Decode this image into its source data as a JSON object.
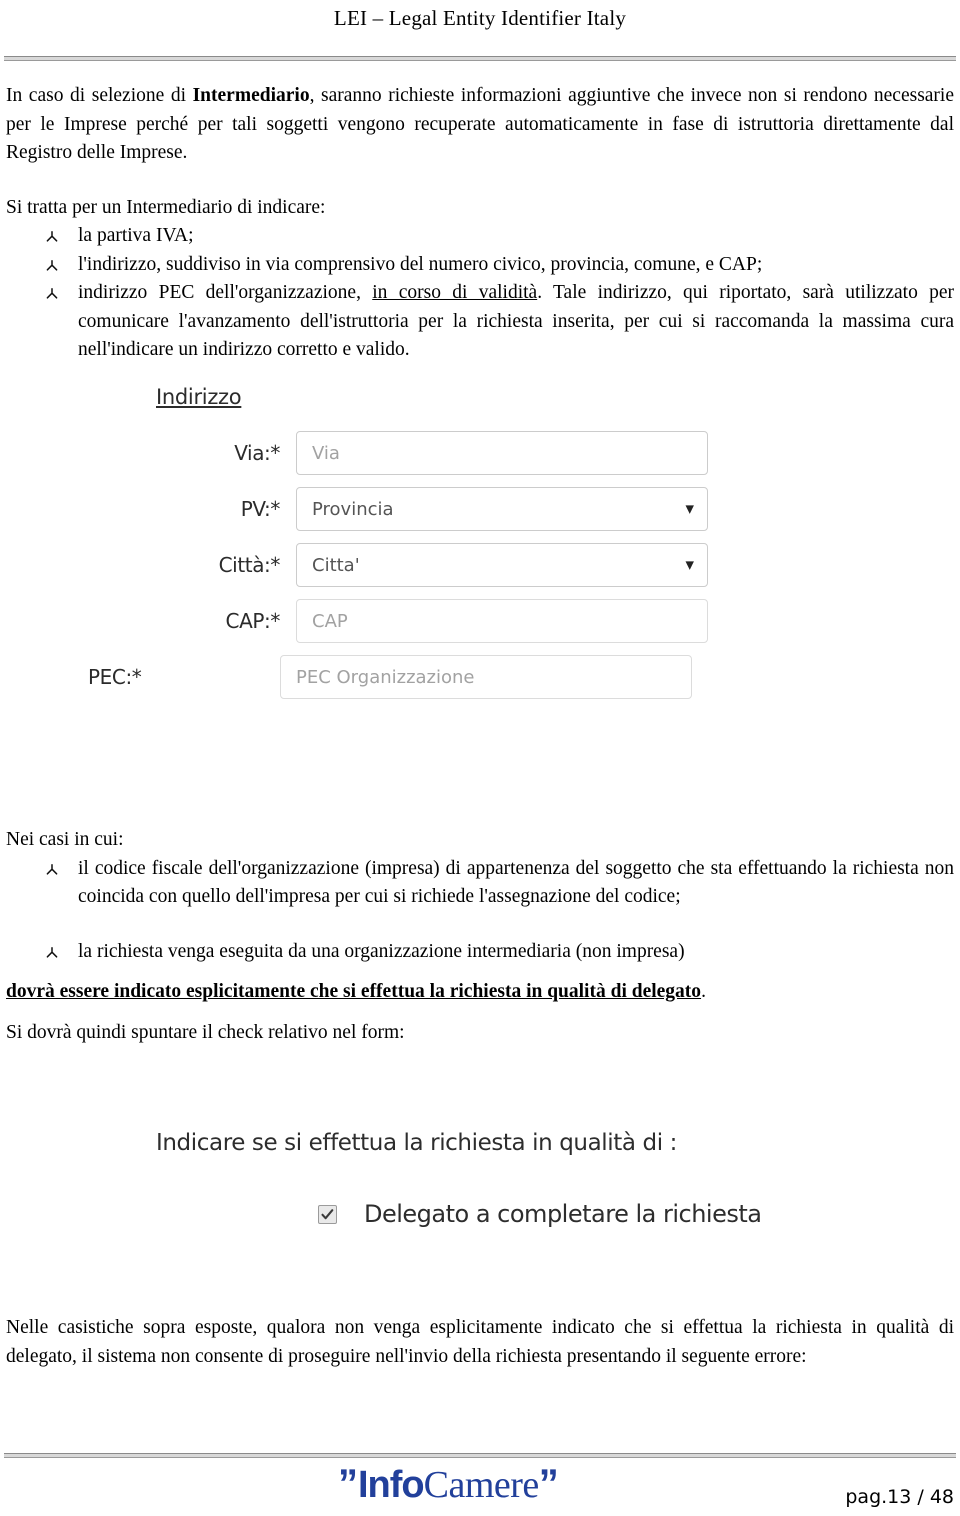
{
  "header": {
    "title": "LEI – Legal Entity Identifier Italy"
  },
  "body": {
    "para1_a": "In caso di selezione di ",
    "para1_b": "Intermediario",
    "para1_c": ", saranno richieste informazioni aggiuntive che invece non si rendono necessarie per le Imprese perché per tali soggetti vengono recuperate automaticamente in fase di istruttoria direttamente dal Registro delle Imprese.",
    "intro2": "Si tratta per un Intermediario di indicare:",
    "bullets1": [
      {
        "text": "la partiva IVA;"
      },
      {
        "text": "l'indirizzo, suddiviso in via comprensivo del numero civico, provincia, comune, e CAP;"
      }
    ],
    "bullet3_a": "indirizzo PEC dell'organizzazione, ",
    "bullet3_b": "in corso di validità",
    "bullet3_c": ". Tale indirizzo, qui riportato, sarà utilizzato per comunicare l'avanzamento dell'istruttoria per la richiesta inserita, per cui si raccomanda la massima cura nell'indicare un indirizzo corretto e valido.",
    "intro3": "Nei casi in cui:",
    "bullets2": [
      {
        "text": "il codice fiscale dell'organizzazione (impresa) di appartenenza del soggetto che sta effettuando la richiesta non coincida con quello dell'impresa per cui si richiede l'assegnazione del codice;"
      },
      {
        "text": "la richiesta venga eseguita da una organizzazione intermediaria (non impresa)"
      }
    ],
    "emphasis": "dovrà essere indicato esplicitamente che si effettua la richiesta in qualità di delegato",
    "emphasis_tail": ".",
    "para_check": "Si dovrà quindi spuntare il check relativo nel form:",
    "para_final": "Nelle casistiche sopra esposte, qualora non venga esplicitamente indicato che si effettua la richiesta in qualità di delegato, il sistema non consente di proseguire nell'invio della richiesta presentando il seguente errore:"
  },
  "form_indirizzo": {
    "title": "Indirizzo",
    "rows": [
      {
        "label": "Via:*",
        "placeholder": "Via",
        "type": "text"
      },
      {
        "label": "PV:*",
        "placeholder": "Provincia",
        "type": "select",
        "caret": "▼"
      },
      {
        "label": "Città:*",
        "placeholder": "Citta'",
        "type": "select",
        "caret": "▼"
      },
      {
        "label": "CAP:*",
        "placeholder": "CAP",
        "type": "text"
      },
      {
        "label": "PEC:*",
        "placeholder": "PEC Organizzazione",
        "type": "text"
      }
    ]
  },
  "form_delega": {
    "title": "Indicare se si effettua la richiesta in qualità di :",
    "checkbox_label": "Delegato a completare la richiesta",
    "checked": true
  },
  "footer": {
    "logo_quote_open": "”",
    "logo_info": "Info",
    "logo_camere": "Camere",
    "logo_quote_close": "”",
    "logo_color": "#22409b",
    "page": "pag.13 / 48"
  }
}
